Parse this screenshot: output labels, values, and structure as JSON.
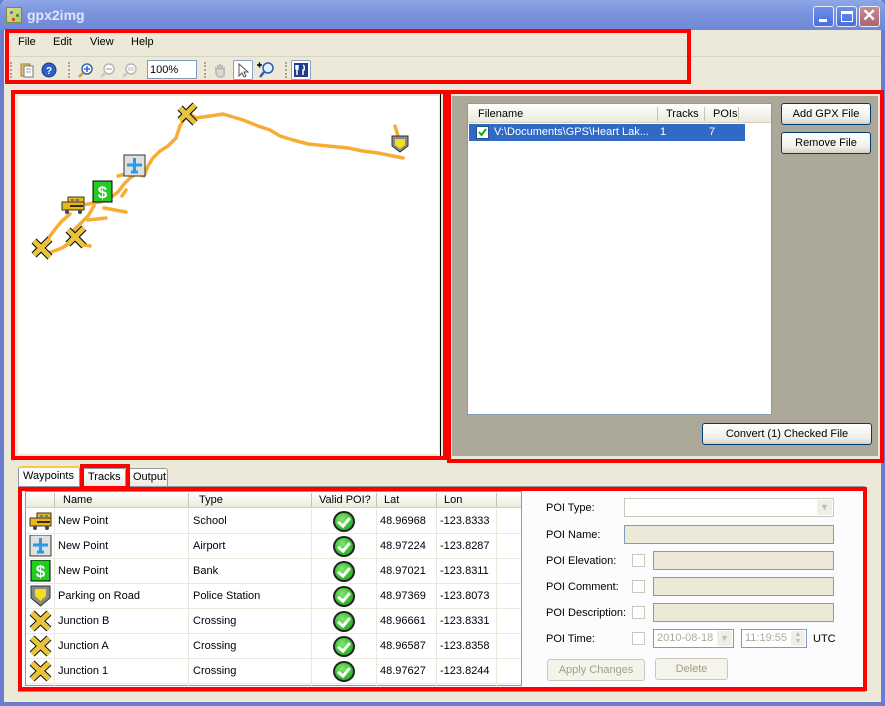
{
  "window": {
    "title": "gpx2img",
    "controls": [
      "minimize",
      "maximize",
      "close"
    ]
  },
  "menubar": {
    "items": [
      "File",
      "Edit",
      "View",
      "Help"
    ]
  },
  "toolbar": {
    "buttons": [
      {
        "name": "open-file",
        "icon": "document-icon"
      },
      {
        "name": "help",
        "icon": "help-icon"
      },
      {
        "name": "zoom-in",
        "icon": "zoom-in-icon"
      },
      {
        "name": "zoom-out",
        "icon": "zoom-out-icon",
        "disabled": true
      },
      {
        "name": "zoom-reset",
        "icon": "zoom-reset-icon",
        "disabled": true
      },
      {
        "name": "pan",
        "icon": "hand-icon",
        "disabled": true
      },
      {
        "name": "select",
        "icon": "pointer-icon",
        "pressed": true
      },
      {
        "name": "zoom-tool",
        "icon": "zoom-plus-icon"
      },
      {
        "name": "poi-tool",
        "icon": "restaurant-icon",
        "pressed": true
      }
    ],
    "zoom_value": "100%"
  },
  "map": {
    "track_color": "#f5a623"
  },
  "files": {
    "columns": [
      "Filename",
      "Tracks",
      "POIs"
    ],
    "rows": [
      {
        "checked": true,
        "filename": "V:\\Documents\\GPS\\Heart Lak...",
        "tracks": "1",
        "pois": "7",
        "selected": true
      }
    ],
    "add_label": "Add GPX File",
    "remove_label": "Remove File",
    "convert_label": "Convert (1) Checked File"
  },
  "tabs": {
    "items": [
      "Waypoints",
      "Tracks",
      "Output"
    ],
    "active": "Waypoints"
  },
  "waypoints": {
    "columns": [
      "",
      "Name",
      "Type",
      "Valid POI?",
      "Lat",
      "Lon"
    ],
    "rows": [
      {
        "icon": "school-bus-icon",
        "name": "New Point",
        "type": "School",
        "valid": true,
        "lat": "48.96968",
        "lon": "-123.8333"
      },
      {
        "icon": "airport-icon",
        "name": "New Point",
        "type": "Airport",
        "valid": true,
        "lat": "48.97224",
        "lon": "-123.8287"
      },
      {
        "icon": "bank-icon",
        "name": "New Point",
        "type": "Bank",
        "valid": true,
        "lat": "48.97021",
        "lon": "-123.8311"
      },
      {
        "icon": "police-icon",
        "name": "Parking on Road",
        "type": "Police Station",
        "valid": true,
        "lat": "48.97369",
        "lon": "-123.8073"
      },
      {
        "icon": "crossing-icon",
        "name": "Junction B",
        "type": "Crossing",
        "valid": true,
        "lat": "48.96661",
        "lon": "-123.8331"
      },
      {
        "icon": "crossing-icon",
        "name": "Junction A",
        "type": "Crossing",
        "valid": true,
        "lat": "48.96587",
        "lon": "-123.8358"
      },
      {
        "icon": "crossing-icon",
        "name": "Junction 1",
        "type": "Crossing",
        "valid": true,
        "lat": "48.97627",
        "lon": "-123.8244"
      }
    ]
  },
  "poi_form": {
    "type_label": "POI Type:",
    "type_value": "",
    "name_label": "POI Name:",
    "name_value": "",
    "elevation_label": "POI Elevation:",
    "comment_label": "POI Comment:",
    "description_label": "POI Description:",
    "time_label": "POI Time:",
    "date_value": "2010-08-18",
    "time_value": "11:19:55",
    "tz_label": "UTC",
    "apply_label": "Apply Changes",
    "delete_label": "Delete"
  }
}
